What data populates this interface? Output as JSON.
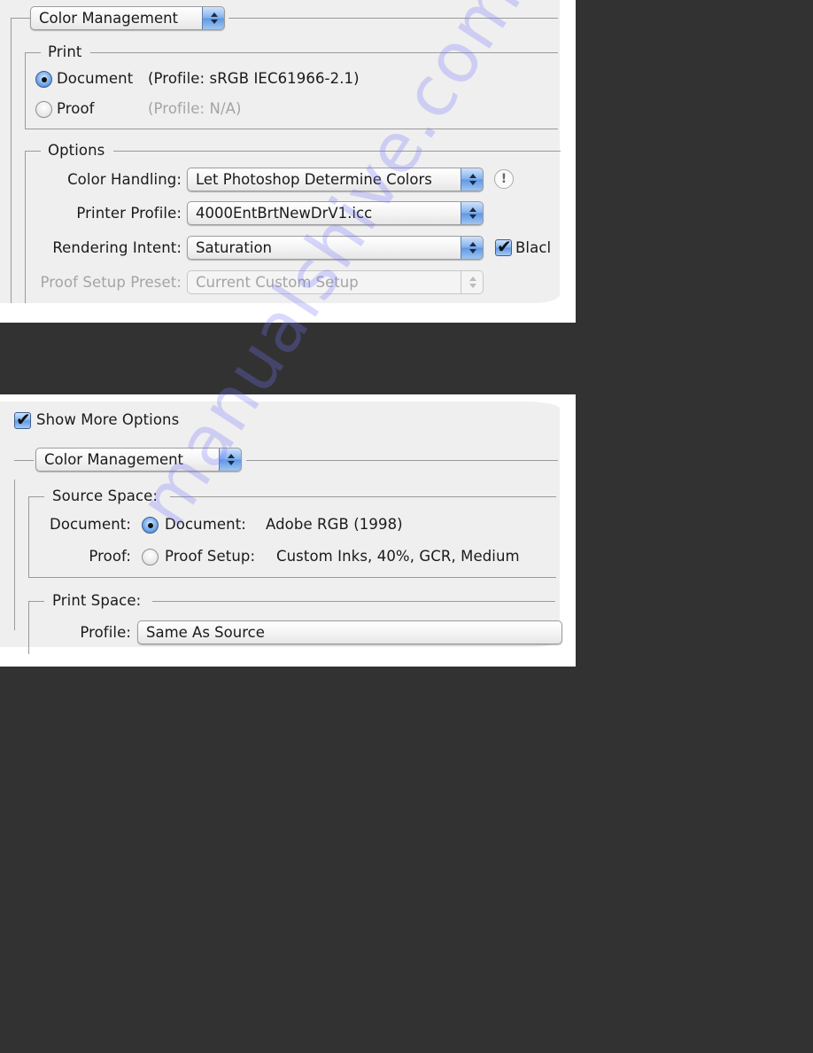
{
  "panel1": {
    "section_select": "Color Management",
    "print_group": {
      "title": "Print",
      "document_radio": {
        "label": "Document",
        "profile": "(Profile: sRGB IEC61966-2.1)",
        "selected": true
      },
      "proof_radio": {
        "label": "Proof",
        "profile": "(Profile: N/A)",
        "selected": false
      }
    },
    "options_group": {
      "title": "Options",
      "color_handling": {
        "label": "Color Handling:",
        "value": "Let Photoshop Determine Colors"
      },
      "printer_profile": {
        "label": "Printer Profile:",
        "value": "4000EntBrtNewDrV1.icc"
      },
      "rendering_intent": {
        "label": "Rendering Intent:",
        "value": "Saturation"
      },
      "black_point_checkbox": {
        "label": "Blacl",
        "checked": true
      },
      "proof_setup_preset": {
        "label": "Proof Setup Preset:",
        "value": "Current Custom Setup",
        "disabled": true
      }
    }
  },
  "panel2": {
    "show_more_options": {
      "label": "Show More Options",
      "checked": true
    },
    "section_select": "Color Management",
    "source_space": {
      "title": "Source Space:",
      "document_row": {
        "label": "Document:",
        "radio_label": "Document:",
        "value": "Adobe RGB (1998)",
        "selected": true
      },
      "proof_row": {
        "label": "Proof:",
        "radio_label": "Proof Setup:",
        "value": "Custom Inks, 40%, GCR, Medium",
        "selected": false
      }
    },
    "print_space": {
      "title": "Print Space:",
      "profile": {
        "label": "Profile:",
        "value": "Same As Source"
      }
    }
  },
  "icons": {
    "info": "!"
  },
  "watermark": "manualshive.com",
  "colors": {
    "background": "#323232",
    "dialog": "#efefef",
    "accent": "#6ea6e8"
  }
}
